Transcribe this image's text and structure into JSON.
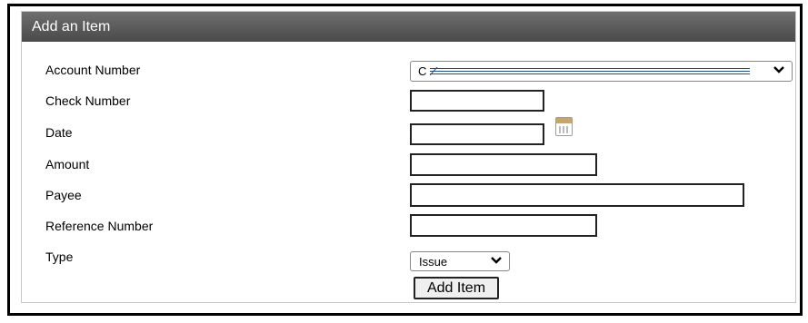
{
  "form": {
    "title": "Add an Item",
    "fields": {
      "account_number": {
        "label": "Account Number",
        "value": "C"
      },
      "check_number": {
        "label": "Check Number",
        "value": ""
      },
      "date": {
        "label": "Date",
        "value": ""
      },
      "amount": {
        "label": "Amount",
        "value": ""
      },
      "payee": {
        "label": "Payee",
        "value": ""
      },
      "reference_number": {
        "label": "Reference Number",
        "value": ""
      },
      "type": {
        "label": "Type",
        "value": "Issue"
      }
    },
    "submit_label": "Add Item"
  },
  "icons": {
    "calendar": "calendar-icon",
    "chevron": "chevron-down-icon"
  },
  "colors": {
    "header_bg": "#555555",
    "header_text": "#ffffff",
    "mask_line": "#1f4f8a"
  }
}
